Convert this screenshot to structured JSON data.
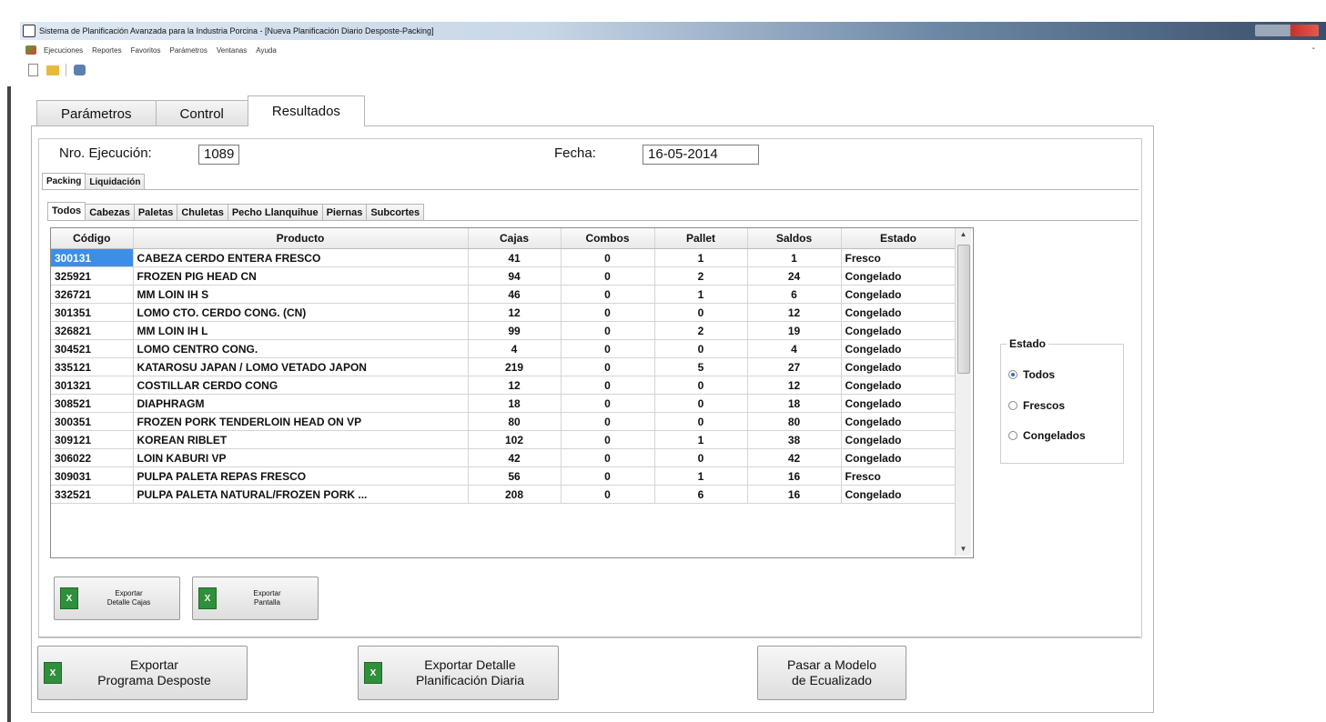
{
  "window": {
    "title": "Sistema de Planificación Avanzada para la Industria Porcina - [Nueva Planificación Diario Desposte-Packing]"
  },
  "menu": {
    "items": [
      "Ejecuciones",
      "Reportes",
      "Favoritos",
      "Parámetros",
      "Ventanas",
      "Ayuda"
    ]
  },
  "main_tabs": [
    "Parámetros",
    "Control",
    "Resultados"
  ],
  "header": {
    "ejecucion_label": "Nro. Ejecución:",
    "ejecucion_value": "1089",
    "fecha_label": "Fecha:",
    "fecha_value": "16-05-2014"
  },
  "subtabs": [
    "Packing",
    "Liquidación"
  ],
  "product_tabs": [
    "Todos",
    "Cabezas",
    "Paletas",
    "Chuletas",
    "Pecho Llanquihue",
    "Piernas",
    "Subcortes"
  ],
  "grid": {
    "columns": [
      "Código",
      "Producto",
      "Cajas",
      "Combos",
      "Pallet",
      "Saldos",
      "Estado"
    ],
    "rows": [
      [
        "300131",
        "CABEZA CERDO ENTERA FRESCO",
        "41",
        "0",
        "1",
        "1",
        "Fresco"
      ],
      [
        "325921",
        "FROZEN PIG HEAD CN",
        "94",
        "0",
        "2",
        "24",
        "Congelado"
      ],
      [
        "326721",
        "MM LOIN IH S",
        "46",
        "0",
        "1",
        "6",
        "Congelado"
      ],
      [
        "301351",
        "LOMO CTO. CERDO CONG. (CN)",
        "12",
        "0",
        "0",
        "12",
        "Congelado"
      ],
      [
        "326821",
        "MM LOIN IH L",
        "99",
        "0",
        "2",
        "19",
        "Congelado"
      ],
      [
        "304521",
        "LOMO CENTRO CONG.",
        "4",
        "0",
        "0",
        "4",
        "Congelado"
      ],
      [
        "335121",
        "KATAROSU JAPAN / LOMO VETADO JAPON",
        "219",
        "0",
        "5",
        "27",
        "Congelado"
      ],
      [
        "301321",
        "COSTILLAR CERDO  CONG",
        "12",
        "0",
        "0",
        "12",
        "Congelado"
      ],
      [
        "308521",
        "DIAPHRAGM",
        "18",
        "0",
        "0",
        "18",
        "Congelado"
      ],
      [
        "300351",
        "FROZEN PORK TENDERLOIN HEAD ON VP",
        "80",
        "0",
        "0",
        "80",
        "Congelado"
      ],
      [
        "309121",
        "KOREAN RIBLET",
        "102",
        "0",
        "1",
        "38",
        "Congelado"
      ],
      [
        "306022",
        "LOIN KABURI VP",
        "42",
        "0",
        "0",
        "42",
        "Congelado"
      ],
      [
        "309031",
        "PULPA PALETA REPAS FRESCO",
        "56",
        "0",
        "1",
        "16",
        "Fresco"
      ],
      [
        "332521",
        "PULPA PALETA NATURAL/FROZEN PORK ...",
        "208",
        "0",
        "6",
        "16",
        "Congelado"
      ]
    ]
  },
  "estado_group": {
    "title": "Estado",
    "options": [
      "Todos",
      "Frescos",
      "Congelados"
    ],
    "selected": "Todos"
  },
  "buttons": {
    "export_detalle_cajas": "Exportar\nDetalle Cajas",
    "export_pantalla": "Exportar\nPantalla",
    "export_programa": "Exportar\nPrograma Desposte",
    "export_planificacion": "Exportar Detalle\nPlanificación Diaria",
    "pasar_modelo": "Pasar a Modelo\nde Ecualizado"
  },
  "icons": {
    "excel": "excel-icon"
  },
  "colors": {
    "selection": "#3d8ee6",
    "excel_green": "#2f8f3b"
  }
}
